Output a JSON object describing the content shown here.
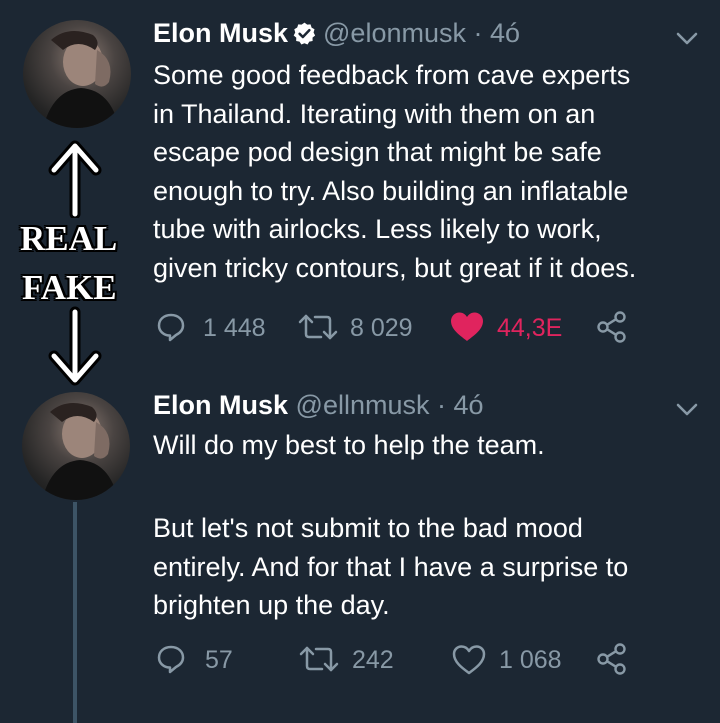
{
  "tweet_real": {
    "author_name": "Elon Musk",
    "handle": "@elonmusk",
    "separator": "·",
    "time": "4ó",
    "text_lines": [
      "Some good feedback from cave experts",
      "in Thailand. Iterating with them on an",
      "escape pod design that might be safe",
      "enough to try. Also building an inflatable",
      "tube with airlocks. Less likely to work,",
      "given tricky contours, but great if it does."
    ],
    "replies": "1 448",
    "retweets": "8 029",
    "likes": "44,3E",
    "liked": true
  },
  "tweet_fake": {
    "author_name": "Elon Musk",
    "handle": "@ellnmusk",
    "separator": "·",
    "time": "4ó",
    "paragraph_1": "Will do my best to help the team.",
    "paragraph_2_lines": [
      "But let's not submit to the bad mood",
      "entirely. And for that I have a surprise to",
      "brighten up the day."
    ],
    "replies": "57",
    "retweets": "242",
    "likes": "1 068",
    "liked": false
  },
  "annotations": {
    "real_label": "REAL",
    "fake_label": "FAKE"
  },
  "colors": {
    "background": "#1c2733",
    "muted_text": "#8899a6",
    "like_red": "#e0245e",
    "verified_badge": "#ffffff",
    "thread_line": "#3d5466"
  },
  "icons": [
    "reply-icon",
    "retweet-icon",
    "like-icon",
    "share-icon",
    "chevron-down-icon",
    "verified-badge-icon",
    "arrow-up-icon",
    "arrow-down-icon"
  ]
}
